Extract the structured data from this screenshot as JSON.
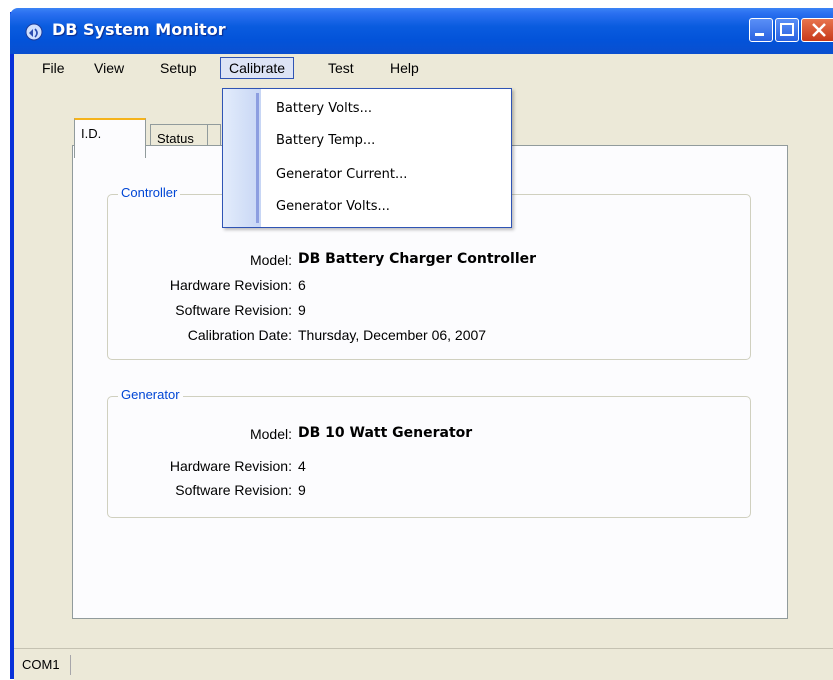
{
  "window": {
    "title": "DB System Monitor"
  },
  "menu": {
    "items": [
      "File",
      "View",
      "Setup",
      "Calibrate",
      "Test",
      "Help"
    ]
  },
  "calibrate_menu": {
    "items": [
      "Battery Volts...",
      "Battery Temp...",
      "Generator Current...",
      "Generator Volts..."
    ]
  },
  "tabs": [
    "I.D.",
    "Status",
    ""
  ],
  "controller": {
    "title": "Controller",
    "model_label": "Model:",
    "model_value": "DB Battery Charger Controller",
    "hw_label": "Hardware Revision:",
    "hw_value": "6",
    "sw_label": "Software Revision:",
    "sw_value": "9",
    "cal_label": "Calibration Date:",
    "cal_value": "Thursday, December 06, 2007"
  },
  "generator": {
    "title": "Generator",
    "model_label": "Model:",
    "model_value": "DB 10 Watt Generator",
    "hw_label": "Hardware Revision:",
    "hw_value": "4",
    "sw_label": "Software Revision:",
    "sw_value": "9"
  },
  "status": {
    "port": "COM1"
  },
  "colors": {
    "title_bar": "#0a5cdf",
    "group_title": "#0046d5",
    "menu_highlight": "#2f54b4"
  }
}
